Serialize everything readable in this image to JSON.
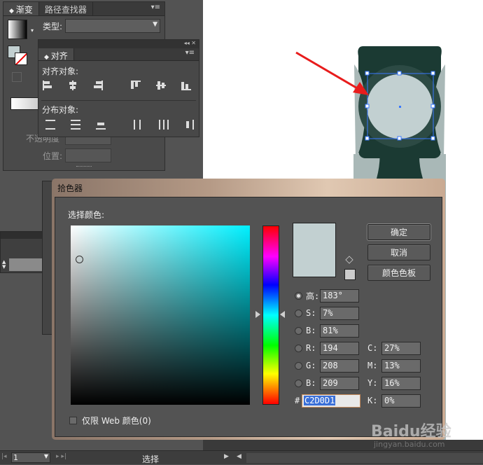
{
  "gradient_panel": {
    "tabs": [
      "渐变",
      "路径查找器"
    ],
    "type_label": "类型:",
    "position_label": "位置:",
    "opacity_label": "不透明度"
  },
  "align_panel": {
    "title": "对齐",
    "align_objects_label": "对齐对象:",
    "distribute_objects_label": "分布对象:"
  },
  "color_picker": {
    "title": "拾色器",
    "select_color_label": "选择颜色:",
    "ok_button": "确定",
    "cancel_button": "取消",
    "swatches_button": "颜色色板",
    "fields": {
      "H": {
        "label": "高:",
        "value": "183°"
      },
      "S": {
        "label": "S:",
        "value": "7%"
      },
      "B": {
        "label": "B:",
        "value": "81%"
      },
      "R": {
        "label": "R:",
        "value": "194"
      },
      "G": {
        "label": "G:",
        "value": "208"
      },
      "B2": {
        "label": "B:",
        "value": "209"
      },
      "C": {
        "label": "C:",
        "value": "27%"
      },
      "M": {
        "label": "M:",
        "value": "13%"
      },
      "Y": {
        "label": "Y:",
        "value": "16%"
      },
      "K": {
        "label": "K:",
        "value": "0%"
      }
    },
    "hex_label": "#",
    "hex_value": "C2D0D1",
    "web_only_label": "仅限 Web 颜色(0)",
    "current_color": "#C2D0D1"
  },
  "statusbar": {
    "page_number": "1",
    "tool_status": "选择"
  },
  "watermark": {
    "brand": "Baidu经验",
    "url": "jingyan.baidu.com"
  },
  "colors": {
    "arrow": "#e81c1c",
    "bottle_dark": "#1b3a33",
    "bottle_light": "#a9b8b7",
    "circle_fill": "#c2d0d1",
    "selection": "#3a78ff"
  }
}
